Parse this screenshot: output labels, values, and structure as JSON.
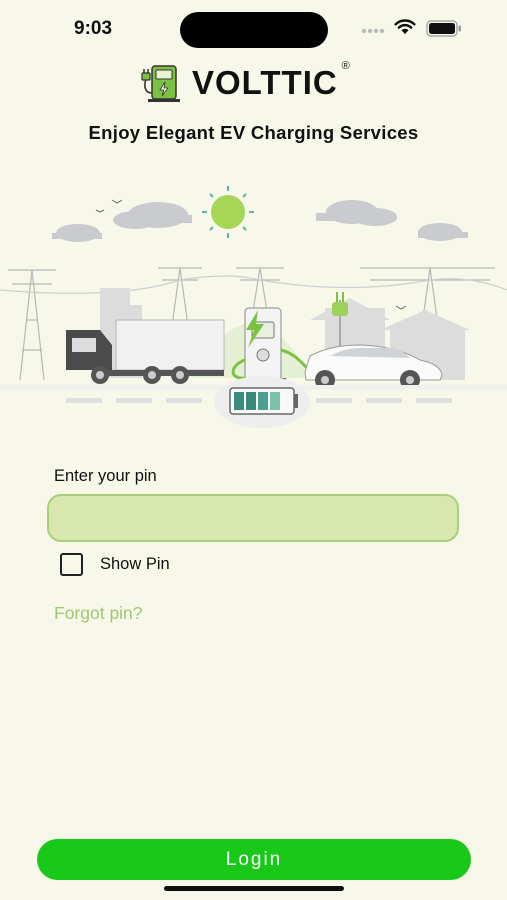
{
  "status": {
    "time": "9:03",
    "icons": [
      "cellular-signal-icon",
      "wifi-icon",
      "battery-icon"
    ]
  },
  "brand": {
    "name": "VOLTTIC",
    "registered": "®",
    "logo_icon": "ev-charger-logo-icon"
  },
  "tagline": "Enjoy Elegant EV Charging Services",
  "form": {
    "pin_label": "Enter your pin",
    "pin_value": "",
    "pin_placeholder": "",
    "show_pin_label": "Show Pin",
    "show_pin_checked": false,
    "forgot_label": "Forgot pin?"
  },
  "login_label": "Login",
  "colors": {
    "background": "#f7f8e9",
    "input_fill": "#d8e7ad",
    "input_border": "#a7d07a",
    "link": "#9fc873",
    "button": "#19c919",
    "accent_green": "#7cc242"
  }
}
